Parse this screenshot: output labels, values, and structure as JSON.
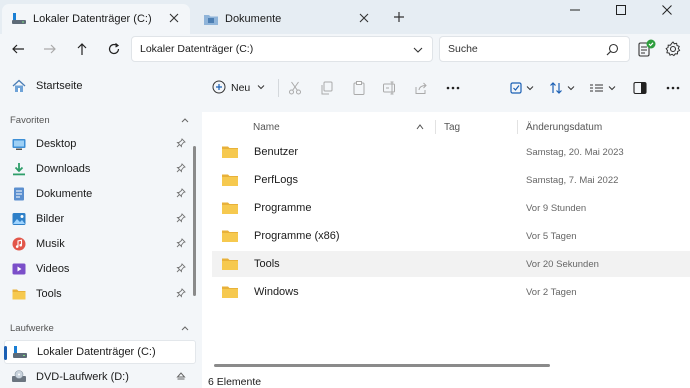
{
  "tabs": [
    {
      "label": "Lokaler Datenträger (C:)",
      "icon": "drive-icon",
      "active": true
    },
    {
      "label": "Dokumente",
      "icon": "documents-folder-icon",
      "active": false
    }
  ],
  "address": {
    "path": "Lokaler Datenträger (C:)"
  },
  "search": {
    "placeholder": "Suche"
  },
  "sidebar": {
    "home": {
      "label": "Startseite",
      "icon": "home-icon"
    },
    "favorites_header": "Favoriten",
    "favorites": [
      {
        "label": "Desktop",
        "icon": "desktop-icon"
      },
      {
        "label": "Downloads",
        "icon": "downloads-icon"
      },
      {
        "label": "Dokumente",
        "icon": "documents-icon"
      },
      {
        "label": "Bilder",
        "icon": "pictures-icon"
      },
      {
        "label": "Musik",
        "icon": "music-icon"
      },
      {
        "label": "Videos",
        "icon": "videos-icon"
      },
      {
        "label": "Tools",
        "icon": "folder-icon"
      }
    ],
    "drives_header": "Laufwerke",
    "drives": [
      {
        "label": "Lokaler Datenträger (C:)",
        "icon": "drive-icon",
        "selected": true
      },
      {
        "label": "DVD-Laufwerk (D:)",
        "icon": "dvd-drive-icon",
        "selected": false
      }
    ]
  },
  "toolbar": {
    "new_label": "Neu"
  },
  "columns": {
    "name": "Name",
    "tag": "Tag",
    "date": "Änderungsdatum"
  },
  "files": [
    {
      "name": "Benutzer",
      "date": "Samstag, 20. Mai 2023"
    },
    {
      "name": "PerfLogs",
      "date": "Samstag, 7. Mai 2022"
    },
    {
      "name": "Programme",
      "date": "Vor 9 Stunden"
    },
    {
      "name": "Programme (x86)",
      "date": "Vor 5 Tagen"
    },
    {
      "name": "Tools",
      "date": "Vor 20 Sekunden"
    },
    {
      "name": "Windows",
      "date": "Vor 2 Tagen"
    }
  ],
  "status": {
    "item_count": "6 Elemente"
  },
  "colors": {
    "accent": "#1a5fb4",
    "folder": "#f4c542",
    "titlebar": "#e6edf3",
    "chrome": "#f3f6f9"
  }
}
